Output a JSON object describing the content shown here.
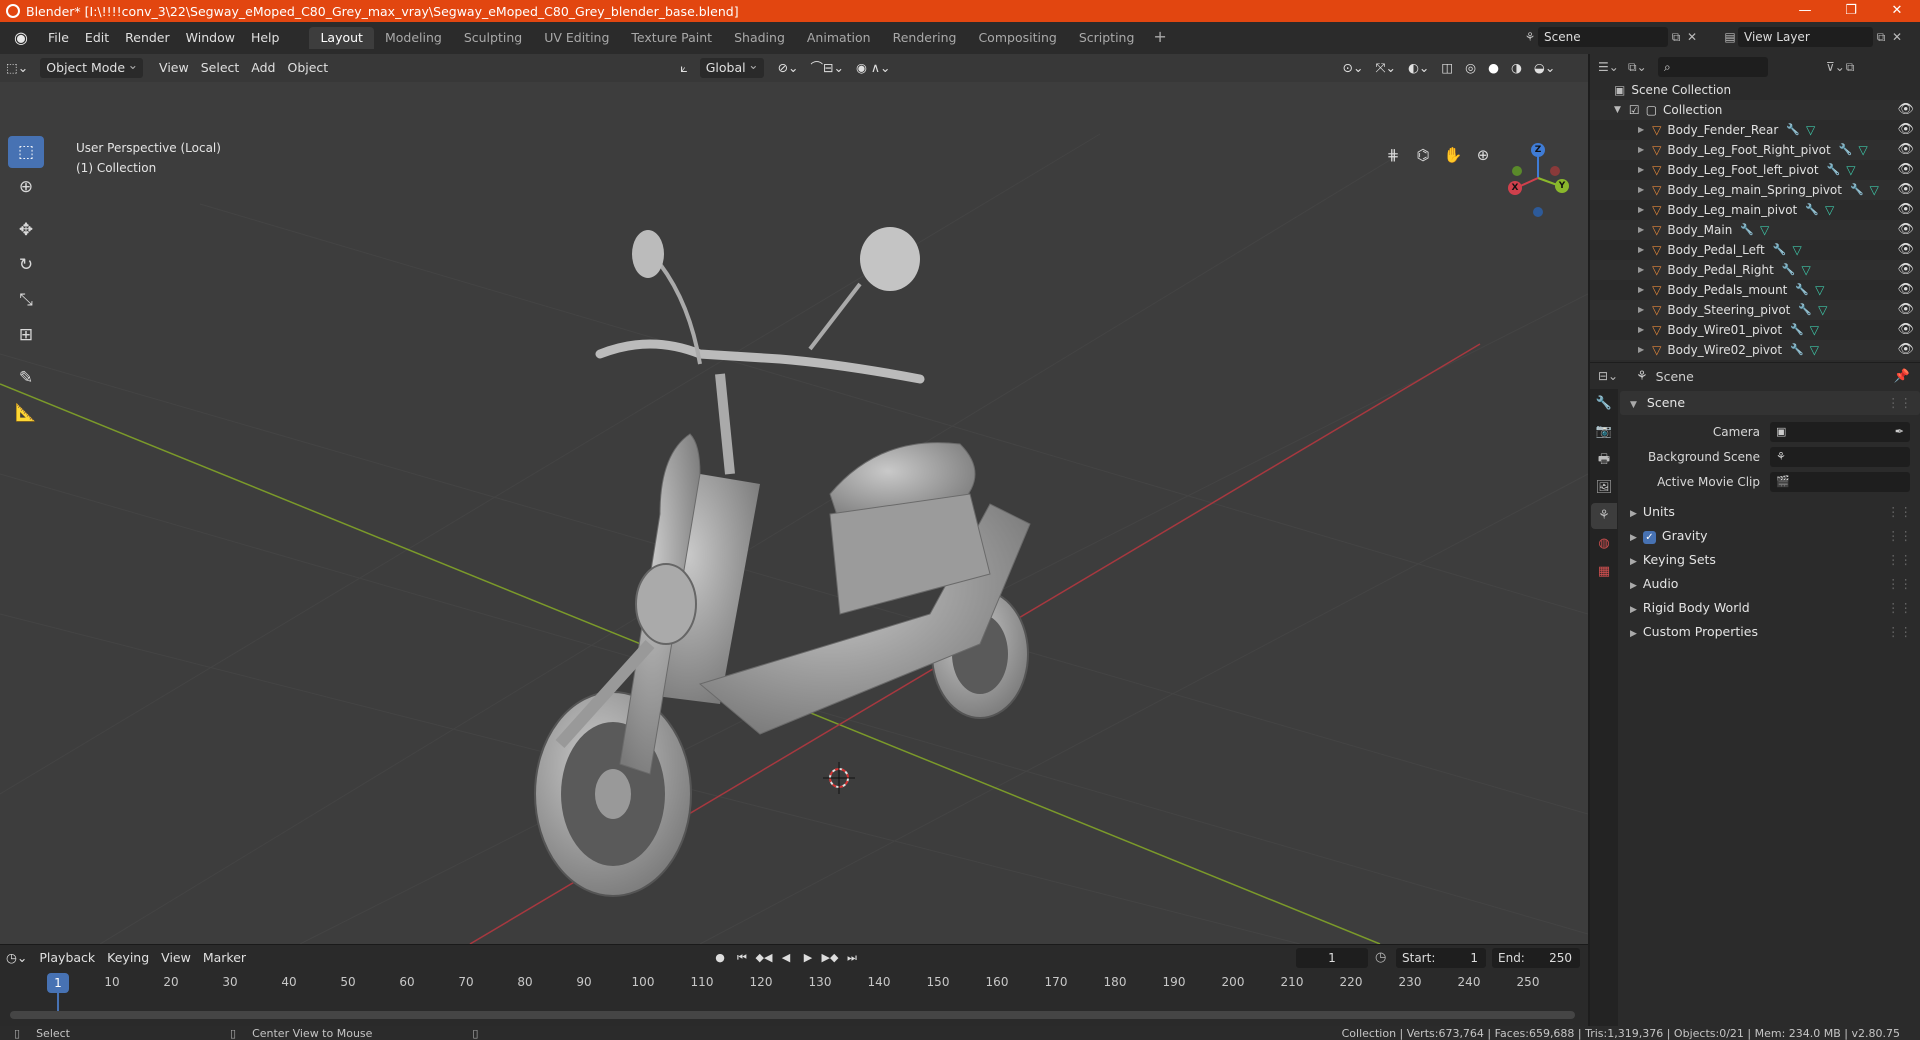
{
  "titlebar": {
    "title": "Blender* [I:\\!!!!conv_3\\22\\Segway_eMoped_C80_Grey_max_vray\\Segway_eMoped_C80_Grey_blender_base.blend]",
    "minimize": "—",
    "maximize": "❐",
    "close": "✕"
  },
  "menubar": {
    "items": [
      "File",
      "Edit",
      "Render",
      "Window",
      "Help"
    ],
    "workspaces": [
      "Layout",
      "Modeling",
      "Sculpting",
      "UV Editing",
      "Texture Paint",
      "Shading",
      "Animation",
      "Rendering",
      "Compositing",
      "Scripting"
    ],
    "active_workspace": "Layout",
    "add_tab": "+",
    "scene": "Scene",
    "view_layer": "View Layer"
  },
  "viewport": {
    "mode": "Object Mode",
    "menus": [
      "View",
      "Select",
      "Add",
      "Object"
    ],
    "orientation": "Global",
    "info_line1": "User Perspective (Local)",
    "info_line2": "(1) Collection",
    "tools": [
      "select-box",
      "cursor",
      "move",
      "rotate",
      "scale",
      "transform",
      "annotate",
      "measure"
    ]
  },
  "timeline": {
    "menus": [
      "Playback",
      "Keying",
      "View",
      "Marker"
    ],
    "current_frame": "1",
    "start_label": "Start:",
    "start": "1",
    "end_label": "End:",
    "end": "250",
    "ruler": [
      "1",
      "10",
      "20",
      "30",
      "40",
      "50",
      "60",
      "70",
      "80",
      "90",
      "100",
      "110",
      "120",
      "130",
      "140",
      "150",
      "160",
      "170",
      "180",
      "190",
      "200",
      "210",
      "220",
      "230",
      "240",
      "250"
    ]
  },
  "outliner": {
    "scene_collection": "Scene Collection",
    "collection": "Collection",
    "objects": [
      "Body_Fender_Rear",
      "Body_Leg_Foot_Right_pivot",
      "Body_Leg_Foot_left_pivot",
      "Body_Leg_main_Spring_pivot",
      "Body_Leg_main_pivot",
      "Body_Main",
      "Body_Pedal_Left",
      "Body_Pedal_Right",
      "Body_Pedals_mount",
      "Body_Steering_pivot",
      "Body_Wire01_pivot",
      "Body_Wire02_pivot"
    ]
  },
  "properties": {
    "header": "Scene",
    "section": "Scene",
    "camera_label": "Camera",
    "background_scene_label": "Background Scene",
    "active_movie_clip_label": "Active Movie Clip",
    "subsections": [
      "Units",
      "Gravity",
      "Keying Sets",
      "Audio",
      "Rigid Body World",
      "Custom Properties"
    ]
  },
  "statusbar": {
    "left_action": "Select",
    "middle_action": "Center View to Mouse",
    "stats": "Collection | Verts:673,764 | Faces:659,688 | Tris:1,319,376 | Objects:0/21 | Mem: 234.0 MB | v2.80.75"
  }
}
